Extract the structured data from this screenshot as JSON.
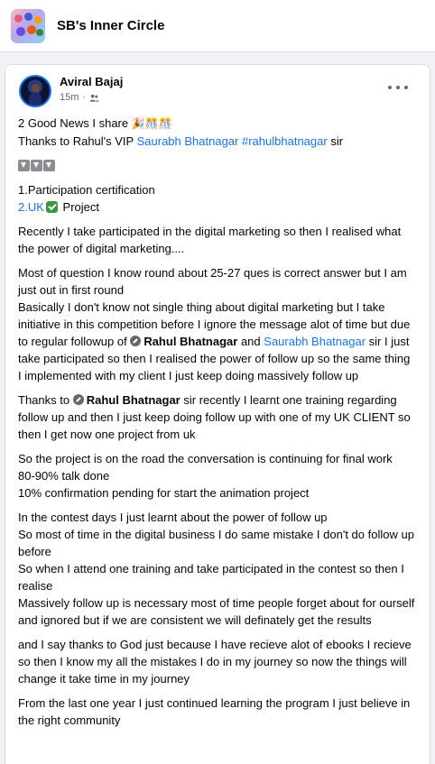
{
  "group": {
    "name": "SB's Inner Circle"
  },
  "post": {
    "author": "Aviral Bajaj",
    "time": "15m",
    "lines": {
      "l1": "2 Good News I share",
      "l1_emoji": "🎉🎊🎊",
      "l2_prefix": "Thanks to Rahul's VIP",
      "l2_link1": "Saurabh Bhatnagar",
      "l2_link2": "#rahulbhatnagar",
      "l2_suffix": "sir",
      "l4": "1.Participation certification",
      "l5_link": "2.UK",
      "l5_suffix": "Project",
      "p2": "Recently I take participated in the digital marketing so then I realised what the power of digital marketing....",
      "p3a": "Most of question I know round about 25-27 ques is correct answer but I am just out in first round",
      "p3b_1": "Basically I don't know not single thing about digital marketing but I take initiative in this competition before I ignore the message alot of time but due to regular followup of",
      "p3b_mention": "Rahul Bhatnagar",
      "p3b_and": "and",
      "p3b_link": "Saurabh Bhatnagar",
      "p3b_2": "sir I just take participated so then I realised the power of follow up so the same thing I implemented with my client I just keep doing massively follow up",
      "p4_1": "Thanks to",
      "p4_mention": "Rahul Bhatnagar",
      "p4_2": "sir recently I learnt one training regarding follow up and then I just keep doing follow up with one of my UK CLIENT so then I get now one project from uk",
      "p5a": "So the project is on the road the conversation is continuing for final work",
      "p5b": "80-90% talk done",
      "p5c": "10% confirmation pending for start the animation project",
      "p6a": "In the contest days I just learnt about the power of follow up",
      "p6b": "So most of time in the digital business I do same mistake I don't do follow up before",
      "p6c": "So when I attend one training and take participated in the contest so then I realise",
      "p6d": "Massively follow up is necessary most of time people forget about for ourself and ignored but if we are consistent we will definately get the results",
      "p7": "and I say thanks to God just because I have recieve alot of ebooks I recieve so then I know my all the mistakes I do in my journey so now the things will change it take time in my journey",
      "p8": "From the last one year I just continued learning the program I just believe in the right community"
    }
  }
}
